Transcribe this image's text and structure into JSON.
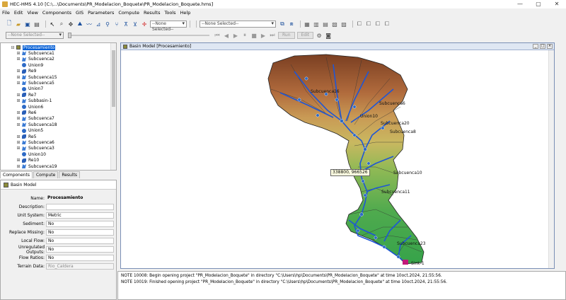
{
  "window": {
    "title": "HEC-HMS 4.10 [C:\\...\\Documents\\PR_Modelacion_Boquete\\PR_Modelacion_Boquete.hms]",
    "controls": [
      "—",
      "▢",
      "✕"
    ]
  },
  "menu": [
    "File",
    "Edit",
    "View",
    "Components",
    "GIS",
    "Parameters",
    "Compute",
    "Results",
    "Tools",
    "Help"
  ],
  "toolbar": {
    "combo1": "--None Selected--",
    "combo2": "--None Selected--",
    "combo3": "--None Selected--",
    "run_label": "Run",
    "edit_label": "Edit"
  },
  "tree": {
    "items": [
      {
        "label": "Procesamiento",
        "type": "basin",
        "level": 0,
        "expander": "⊟",
        "selected": true
      },
      {
        "label": "Subcuenca1",
        "type": "sub",
        "level": 1,
        "expander": "⊞"
      },
      {
        "label": "Subcuenca2",
        "type": "sub",
        "level": 1,
        "expander": "⊞"
      },
      {
        "label": "Union9",
        "type": "junc",
        "level": 1,
        "expander": ""
      },
      {
        "label": "Re9",
        "type": "reach",
        "level": 1,
        "expander": "⊞"
      },
      {
        "label": "Subcuenca15",
        "type": "sub",
        "level": 1,
        "expander": "⊞"
      },
      {
        "label": "Subcuenca5",
        "type": "sub",
        "level": 1,
        "expander": "⊞"
      },
      {
        "label": "Union7",
        "type": "junc",
        "level": 1,
        "expander": ""
      },
      {
        "label": "Re7",
        "type": "reach",
        "level": 1,
        "expander": "⊞"
      },
      {
        "label": "Subbasin-1",
        "type": "sub",
        "level": 1,
        "expander": "⊞"
      },
      {
        "label": "Union6",
        "type": "junc",
        "level": 1,
        "expander": ""
      },
      {
        "label": "Re6",
        "type": "reach",
        "level": 1,
        "expander": "⊞"
      },
      {
        "label": "Subcuenca7",
        "type": "sub",
        "level": 1,
        "expander": "⊞"
      },
      {
        "label": "Subcuenca18",
        "type": "sub",
        "level": 1,
        "expander": "⊞"
      },
      {
        "label": "Union5",
        "type": "junc",
        "level": 1,
        "expander": ""
      },
      {
        "label": "Re5",
        "type": "reach",
        "level": 1,
        "expander": "⊞"
      },
      {
        "label": "Subcuenca6",
        "type": "sub",
        "level": 1,
        "expander": "⊞"
      },
      {
        "label": "Subcuenca3",
        "type": "sub",
        "level": 1,
        "expander": "⊞"
      },
      {
        "label": "Union10",
        "type": "junc",
        "level": 1,
        "expander": ""
      },
      {
        "label": "Re10",
        "type": "reach",
        "level": 1,
        "expander": "⊞"
      },
      {
        "label": "Subcuenca19",
        "type": "sub",
        "level": 1,
        "expander": "⊞"
      }
    ]
  },
  "tabs": [
    "Components",
    "Compute",
    "Results"
  ],
  "properties": {
    "header": "Basin Model",
    "rows": [
      {
        "label": "Name:",
        "value": "Procesamiento",
        "kind": "name"
      },
      {
        "label": "Description:",
        "value": "",
        "kind": "field"
      },
      {
        "label": "Unit System:",
        "value": "Metric",
        "kind": "field"
      },
      {
        "label": "Sediment:",
        "value": "No",
        "kind": "field"
      },
      {
        "label": "Replace Missing:",
        "value": "No",
        "kind": "field"
      },
      {
        "label": "Local Flow:",
        "value": "No",
        "kind": "field"
      },
      {
        "label": "Unregulated Outputs:",
        "value": "No",
        "kind": "field"
      },
      {
        "label": "Flow Ratios:",
        "value": "No",
        "kind": "field"
      },
      {
        "label": "Terrain Data:",
        "value": "Rio_Caldera",
        "kind": "dim"
      }
    ]
  },
  "map": {
    "window_title": "Basin Model [Procesamiento]",
    "tooltip": "338800, 966526",
    "labels": [
      {
        "text": "Subcuenca16"
      },
      {
        "text": "Subcuenca6"
      },
      {
        "text": "Union10"
      },
      {
        "text": "Subcuenca20"
      },
      {
        "text": "Subcuenca8"
      },
      {
        "text": "Subcuenca10"
      },
      {
        "text": "Subcuenca11"
      },
      {
        "text": "Subcuenca23"
      },
      {
        "text": "Sink-1"
      }
    ]
  },
  "messages": [
    "NOTE 10008:  Begin opening project \"PR_Modelacion_Boquete\" in directory \"C:\\Users\\hp\\Documents\\PR_Modelacion_Boquete\" at time 10oct.2024, 21:55:56.",
    "NOTE 10019:  Finished opening project \"PR_Modelacion_Boquete\" in directory \"C:\\Users\\hp\\Documents\\PR_Modelacion_Boquete\" at time 10oct.2024, 21:55:56."
  ],
  "colors": {
    "accent": "#0a62d6",
    "river": "#1e56d6",
    "terrain_high": "#8a4a2a",
    "terrain_low": "#3aa84a"
  }
}
